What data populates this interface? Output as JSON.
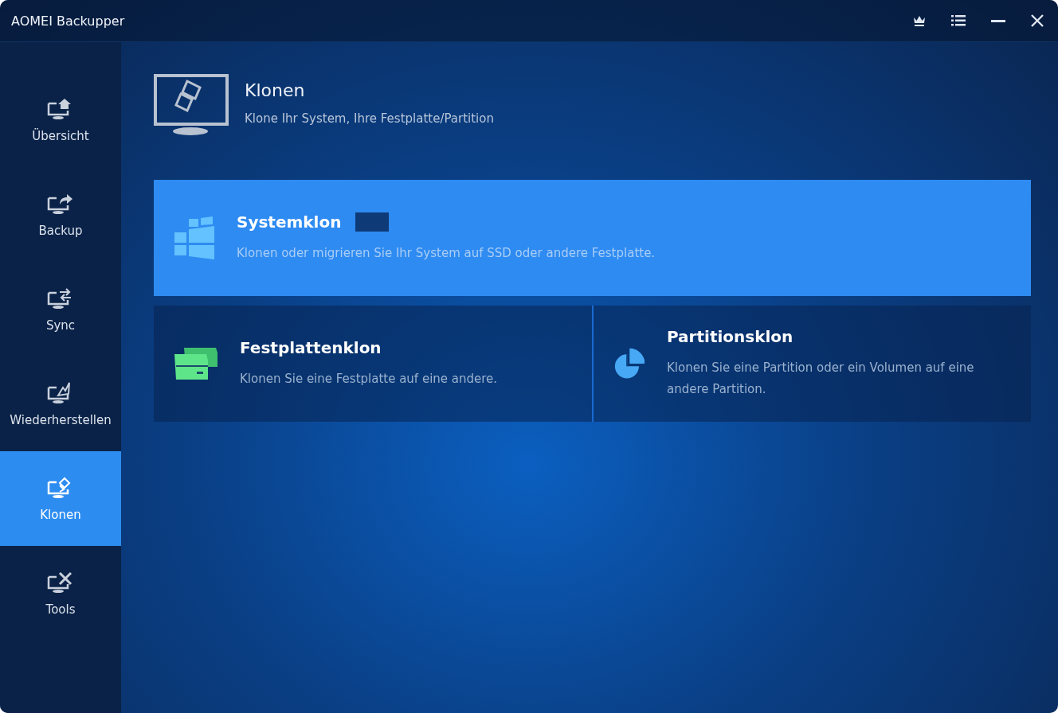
{
  "window": {
    "title": "AOMEI Backupper"
  },
  "sidebar": {
    "items": [
      {
        "label": "Übersicht",
        "selected": false
      },
      {
        "label": "Backup",
        "selected": false
      },
      {
        "label": "Sync",
        "selected": false
      },
      {
        "label": "Wiederherstellen",
        "selected": false
      },
      {
        "label": "Klonen",
        "selected": true
      },
      {
        "label": "Tools",
        "selected": false
      }
    ]
  },
  "header": {
    "title": "Klonen",
    "subtitle": "Klone Ihr System, Ihre Festplatte/Partition"
  },
  "options": [
    {
      "kind": "system",
      "title": "Systemklon",
      "description": "Klonen oder migrieren Sie Ihr System auf SSD oder andere Festplatte.",
      "selected": true
    },
    {
      "kind": "disk",
      "title": "Festplattenklon",
      "description": "Klonen Sie eine Festplatte auf eine andere.",
      "selected": false
    },
    {
      "kind": "partition",
      "title": "Partitionsklon",
      "description": "Klonen Sie eine Partition oder ein Volumen auf eine andere Partition.",
      "selected": false
    }
  ]
}
